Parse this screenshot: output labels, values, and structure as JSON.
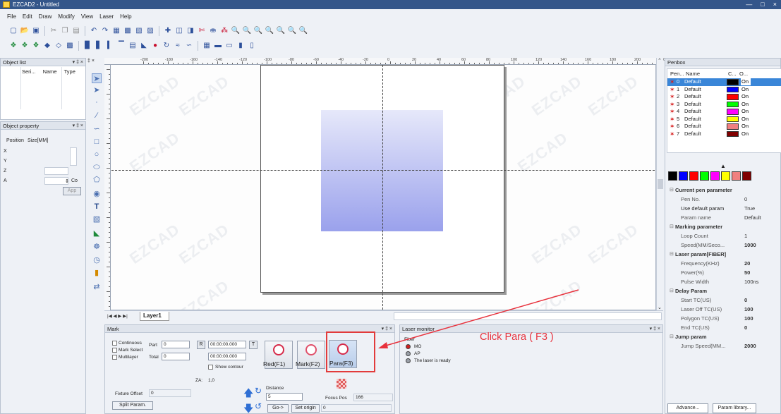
{
  "window": {
    "title": "EZCAD2 - Untitled"
  },
  "menu": [
    "File",
    "Edit",
    "Draw",
    "Modify",
    "View",
    "Laser",
    "Help"
  ],
  "object_list": {
    "title": "Object list",
    "columns": [
      "Seri...",
      "Name",
      "Type"
    ]
  },
  "object_property": {
    "title": "Object property",
    "position_label": "Position",
    "size_label": "Size[MM]",
    "rows": [
      "X",
      "Y",
      "Z",
      "A"
    ],
    "co_label": "Co",
    "apply_label": "App"
  },
  "ruler": {
    "top_ticks": [
      "-200",
      "-180",
      "-160",
      "-140",
      "-120",
      "-100",
      "-80",
      "-60",
      "-40",
      "-20",
      "0",
      "20",
      "40",
      "60",
      "80",
      "100",
      "120",
      "140",
      "160",
      "180",
      "200",
      "220"
    ]
  },
  "watermark": "EZCAD",
  "layer_tab": "Layer1",
  "mark_panel": {
    "title": "Mark",
    "continuous_label": "Continuous",
    "mark_select_label": "Mark Select",
    "multilayer_label": "Multilayer",
    "part_label": "Part",
    "part_value": "0",
    "total_label": "Total",
    "total_value": "0",
    "r_label": "R",
    "t_label": "T",
    "time1": "00:00:00.000",
    "time2": "00:00:00.000",
    "show_contour": "Show contour",
    "red_label": "Red(F1)",
    "mark_label": "Mark(F2)",
    "para_label": "Para(F3)",
    "za_label": "ZA:",
    "za_value": "1,0",
    "fixture_offset_label": "Fixture Offset",
    "fixture_offset_value": "0",
    "split_param_label": "Split Param.",
    "distance_label": "Distance",
    "distance_value": "5",
    "focus_pos_label": "Focus Pos",
    "focus_pos_value": "166",
    "go_label": "Go->",
    "set_origin_label": "Set origin",
    "origin_value": "0"
  },
  "laser_monitor": {
    "title": "Laser monitor",
    "fiber_label": "Fiber",
    "mo_label": "MO",
    "ap_label": "AP",
    "status": "The laser is ready"
  },
  "annotation": "Click Para ( F3 )",
  "penbox": {
    "title": "Penbox",
    "columns": [
      "Pen...",
      "Name",
      "C...",
      "O..."
    ],
    "pens": [
      {
        "no": "0",
        "name": "Default",
        "color": "#000000",
        "on": "On"
      },
      {
        "no": "1",
        "name": "Default",
        "color": "#0000ff",
        "on": "On"
      },
      {
        "no": "2",
        "name": "Default",
        "color": "#ff0000",
        "on": "On"
      },
      {
        "no": "3",
        "name": "Default",
        "color": "#00ff00",
        "on": "On"
      },
      {
        "no": "4",
        "name": "Default",
        "color": "#ff00ff",
        "on": "On"
      },
      {
        "no": "5",
        "name": "Default",
        "color": "#ffff00",
        "on": "On"
      },
      {
        "no": "6",
        "name": "Default",
        "color": "#f08080",
        "on": "On"
      },
      {
        "no": "7",
        "name": "Default",
        "color": "#800000",
        "on": "On"
      }
    ],
    "palette": [
      "#000000",
      "#0000ff",
      "#ff0000",
      "#00ff00",
      "#ff00ff",
      "#ffff00",
      "#f08080",
      "#800000"
    ],
    "params": [
      {
        "type": "hdr",
        "k": "Current pen parameter"
      },
      {
        "type": "row",
        "k": "Pen No.",
        "v": "0"
      },
      {
        "type": "row",
        "k": "Use default param",
        "v": "True",
        "dark": true
      },
      {
        "type": "row",
        "k": "Param name",
        "v": "Default"
      },
      {
        "type": "hdr",
        "k": "Marking parameter"
      },
      {
        "type": "row",
        "k": "Loop Count",
        "v": "1"
      },
      {
        "type": "row",
        "k": "Speed(MM/Seco...",
        "v": "1000",
        "bold": true
      },
      {
        "type": "hdr",
        "k": "Laser param[FIBER]"
      },
      {
        "type": "row",
        "k": "Frequency(KHz)",
        "v": "20",
        "bold": true
      },
      {
        "type": "row",
        "k": "Power(%)",
        "v": "50",
        "bold": true
      },
      {
        "type": "row",
        "k": "Pulse Width",
        "v": "100ns"
      },
      {
        "type": "hdr",
        "k": "Delay Param"
      },
      {
        "type": "row",
        "k": "Start TC(US)",
        "v": "0",
        "bold": true
      },
      {
        "type": "row",
        "k": "Laser Off TC(US)",
        "v": "100",
        "bold": true
      },
      {
        "type": "row",
        "k": "Polygon TC(US)",
        "v": "100",
        "bold": true
      },
      {
        "type": "row",
        "k": "End TC(US)",
        "v": "0",
        "bold": true
      },
      {
        "type": "hdr",
        "k": "Jump param"
      },
      {
        "type": "row",
        "k": "Jump Speed(MM...",
        "v": "2000",
        "bold": true
      }
    ],
    "advance_label": "Advance...",
    "param_library_label": "Param library..."
  }
}
